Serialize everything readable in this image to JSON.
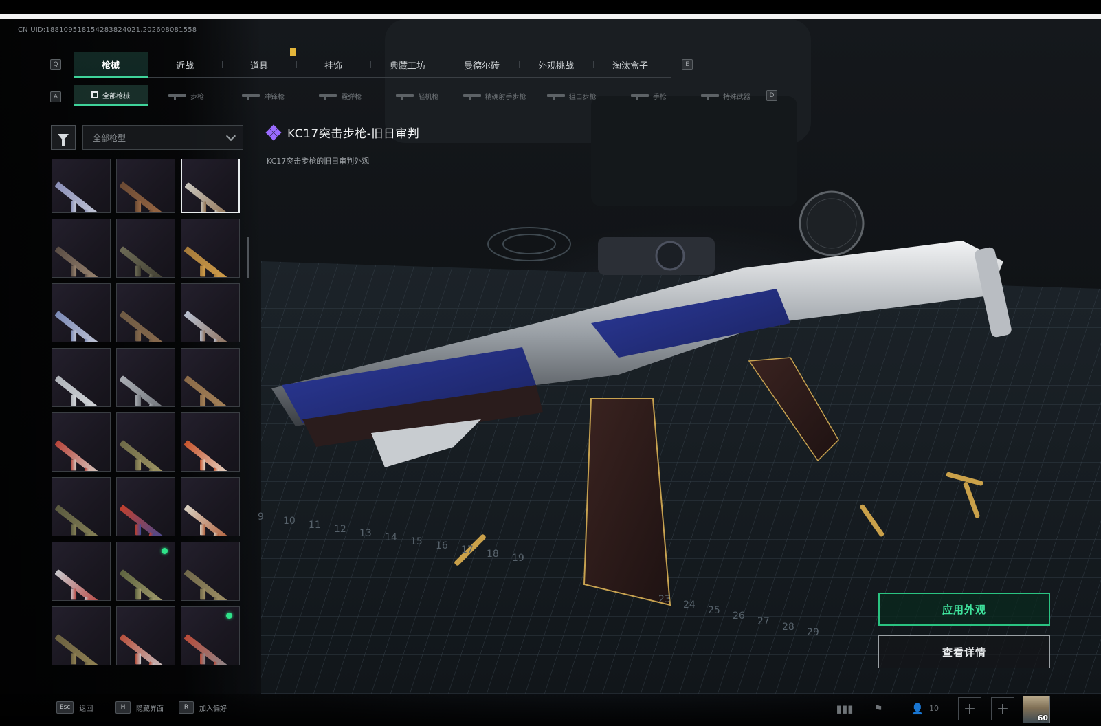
{
  "header": {
    "uid": "CN UID:1881095181542838240​21,202608081558"
  },
  "tabs": {
    "left_key": "Q",
    "right_key": "E",
    "items": [
      "枪械",
      "近战",
      "道具",
      "挂饰",
      "典藏工坊",
      "曼德尔砖",
      "外观挑战",
      "淘汰盒子"
    ],
    "active_index": 0
  },
  "subtabs": {
    "left_key": "A",
    "right_key": "D",
    "items": [
      "全部枪械",
      "步枪",
      "冲锋枪",
      "霰弹枪",
      "轻机枪",
      "精确射手步枪",
      "狙击步枪",
      "手枪",
      "特殊武器"
    ],
    "active_index": 0
  },
  "filter": {
    "dropdown_value": "全部枪型"
  },
  "item": {
    "name": "KC17突击步枪-旧日审判",
    "description": "KC17突击步枪的旧日审判外观",
    "rarity_color": "#9a6bff"
  },
  "grid": {
    "cells": [
      {
        "colors": [
          "#8a8fb8",
          "#c8ccd8"
        ],
        "selected": false,
        "new": false
      },
      {
        "colors": [
          "#6b4a34",
          "#9c6a45"
        ],
        "selected": false,
        "new": false
      },
      {
        "colors": [
          "#c9c6bd",
          "#8a6a4a"
        ],
        "selected": true,
        "new": false
      },
      {
        "colors": [
          "#5a4d45",
          "#a08a74"
        ],
        "selected": false,
        "new": false
      },
      {
        "colors": [
          "#6c6a55",
          "#3e3c30"
        ],
        "selected": false,
        "new": false
      },
      {
        "colors": [
          "#a57a3a",
          "#d6a24c"
        ],
        "selected": false,
        "new": false
      },
      {
        "colors": [
          "#7c8bb8",
          "#c4c8d6"
        ],
        "selected": false,
        "new": false
      },
      {
        "colors": [
          "#6e5a44",
          "#8a6b4d"
        ],
        "selected": false,
        "new": false
      },
      {
        "colors": [
          "#b8c0d0",
          "#8a6a52"
        ],
        "selected": false,
        "new": false
      },
      {
        "colors": [
          "#b0b4ba",
          "#d6d9dc"
        ],
        "selected": false,
        "new": false
      },
      {
        "colors": [
          "#a8acb2",
          "#6e7278"
        ],
        "selected": false,
        "new": false
      },
      {
        "colors": [
          "#8a6a48",
          "#a8845a"
        ],
        "selected": false,
        "new": false
      },
      {
        "colors": [
          "#b8443a",
          "#d8d4cc"
        ],
        "selected": false,
        "new": false
      },
      {
        "colors": [
          "#6e6a48",
          "#a49a66"
        ],
        "selected": false,
        "new": false
      },
      {
        "colors": [
          "#c8542c",
          "#e6e0d4"
        ],
        "selected": false,
        "new": false
      },
      {
        "colors": [
          "#5a5a40",
          "#8a8458"
        ],
        "selected": false,
        "new": false
      },
      {
        "colors": [
          "#c0402e",
          "#3e4a9a"
        ],
        "selected": false,
        "new": false
      },
      {
        "colors": [
          "#d8cfc0",
          "#b05a34"
        ],
        "selected": false,
        "new": false
      },
      {
        "colors": [
          "#c8c8cc",
          "#b8403a"
        ],
        "selected": false,
        "new": false
      },
      {
        "colors": [
          "#5e6440",
          "#a8a070"
        ],
        "selected": false,
        "new": true
      },
      {
        "colors": [
          "#70684a",
          "#a49468"
        ],
        "selected": false,
        "new": false
      },
      {
        "colors": [
          "#6a6040",
          "#968656"
        ],
        "selected": false,
        "new": false
      },
      {
        "colors": [
          "#b8503c",
          "#c8c8cc"
        ],
        "selected": false,
        "new": false
      },
      {
        "colors": [
          "#b84a38",
          "#8a8e94"
        ],
        "selected": false,
        "new": true
      },
      {
        "colors": [
          "#8a8ea8",
          "#b8bcc8"
        ],
        "selected": false,
        "new": false
      },
      {
        "colors": [
          "#c07a3a",
          "#d8a25a"
        ],
        "selected": false,
        "new": false
      },
      {
        "colors": [
          "#c0502e",
          "#8a8e94"
        ],
        "selected": false,
        "new": false
      }
    ]
  },
  "actions": {
    "apply": "应用外观",
    "details": "查看详情"
  },
  "bottom_hints": [
    {
      "key": "Esc",
      "label": "返回"
    },
    {
      "key": "H",
      "label": "隐藏界面"
    },
    {
      "key": "R",
      "label": "加入偏好"
    }
  ],
  "bottom_right": {
    "friends_count": "10",
    "level": "60"
  },
  "ruler_numbers": [
    "9",
    "10",
    "11",
    "12",
    "13",
    "14",
    "15",
    "16",
    "17",
    "18",
    "19"
  ],
  "ruler_numbers_right": [
    "23",
    "24",
    "25",
    "26",
    "27",
    "28",
    "29"
  ]
}
